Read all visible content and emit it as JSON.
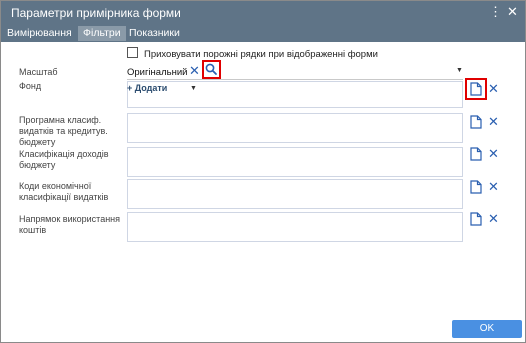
{
  "window": {
    "title": "Параметри примірника форми",
    "more_glyph": "⋮",
    "close_glyph": "✕"
  },
  "tabs": [
    {
      "label": "Вимірювання",
      "active": false
    },
    {
      "label": "Фільтри",
      "active": true
    },
    {
      "label": "Показники",
      "active": false
    }
  ],
  "options": {
    "hide_empty_rows_label": "Приховувати порожні рядки при відображенні форми",
    "hide_empty_rows_checked": false
  },
  "filters": {
    "scale": {
      "label": "Масштаб",
      "value": "Оригінальний"
    },
    "fund": {
      "label": "Фонд",
      "add_label": "+ Додати"
    },
    "program_class": {
      "label": "Програмна класиф. видатків та кредитув. бюджету"
    },
    "income_class": {
      "label": "Класифікація доходів бюджету"
    },
    "economic_codes": {
      "label": "Коди економічної класифікації видатків"
    },
    "usage_direction": {
      "label": "Напрямок використання коштів"
    }
  },
  "icons": {
    "clear": "clear-icon",
    "search": "search-icon",
    "document": "document-icon",
    "dropdown": "chevron-down-icon"
  },
  "colors": {
    "titlebar": "#5f7487",
    "accent": "#2a5fb0",
    "highlight": "#e00000",
    "ok_button": "#4a90e2"
  },
  "footer": {
    "ok_label": "OK"
  }
}
